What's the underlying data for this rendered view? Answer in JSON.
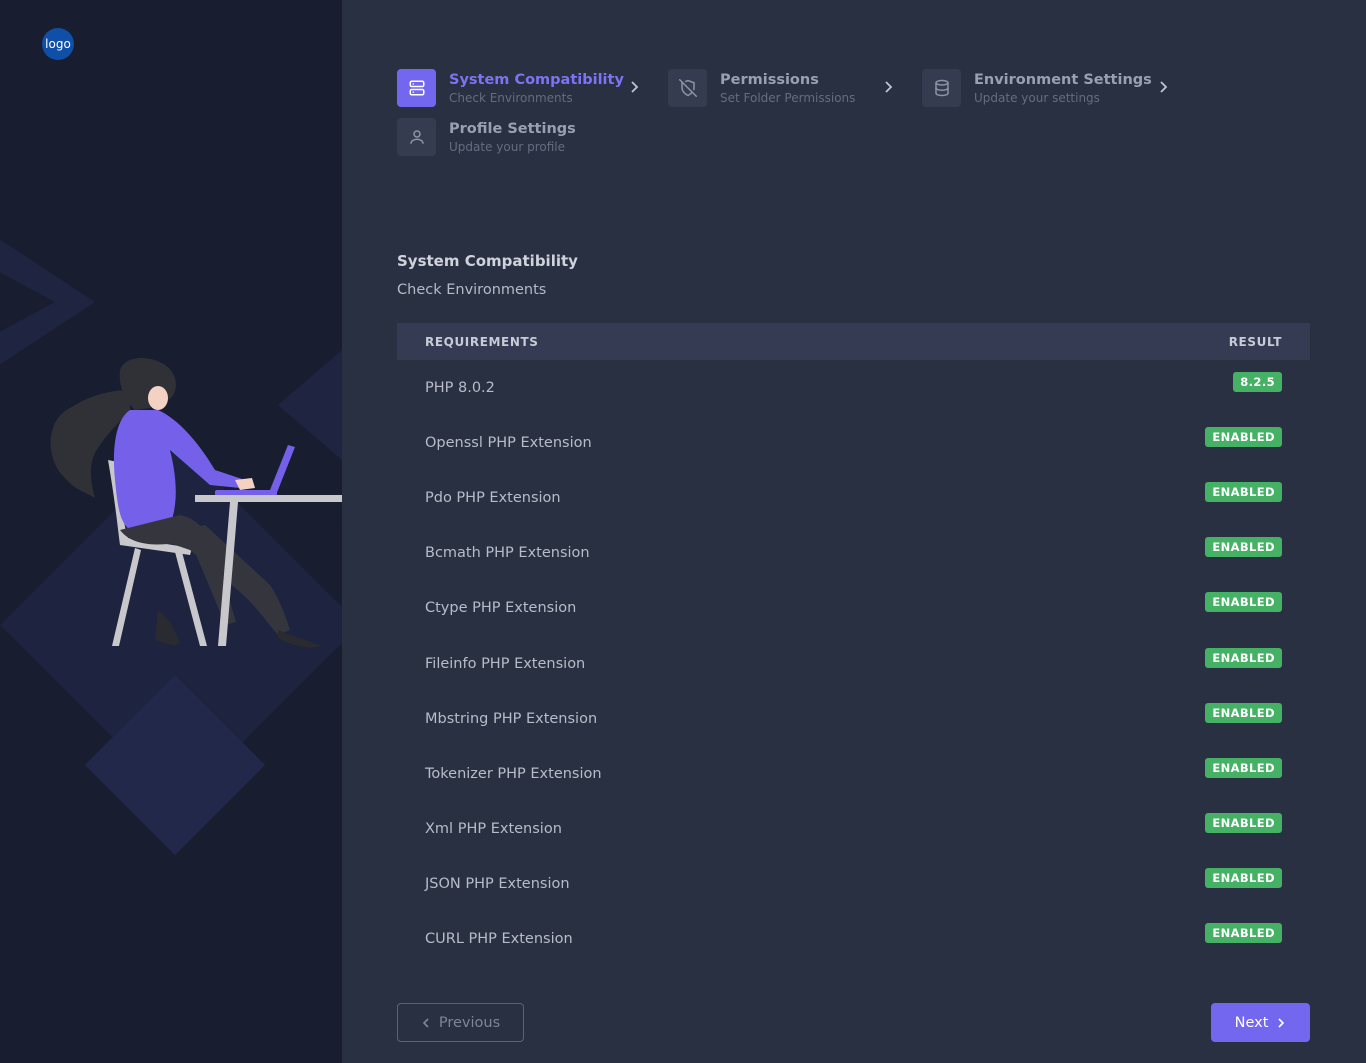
{
  "brand": {
    "logo_text": "logo"
  },
  "steps": [
    {
      "title": "System Compatibility",
      "subtitle": "Check Environments",
      "icon": "server-icon",
      "active": true
    },
    {
      "title": "Permissions",
      "subtitle": "Set Folder Permissions",
      "icon": "shield-off-icon",
      "active": false
    },
    {
      "title": "Environment Settings",
      "subtitle": "Update your settings",
      "icon": "database-icon",
      "active": false
    },
    {
      "title": "Profile Settings",
      "subtitle": "Update your profile",
      "icon": "user-icon",
      "active": false
    }
  ],
  "section": {
    "title": "System Compatibility",
    "subtitle": "Check Environments"
  },
  "table": {
    "headers": {
      "requirements": "REQUIREMENTS",
      "result": "RESULT"
    },
    "rows": [
      {
        "name": "PHP 8.0.2",
        "result": "8.2.5"
      },
      {
        "name": "Openssl PHP Extension",
        "result": "ENABLED"
      },
      {
        "name": "Pdo PHP Extension",
        "result": "ENABLED"
      },
      {
        "name": "Bcmath PHP Extension",
        "result": "ENABLED"
      },
      {
        "name": "Ctype PHP Extension",
        "result": "ENABLED"
      },
      {
        "name": "Fileinfo PHP Extension",
        "result": "ENABLED"
      },
      {
        "name": "Mbstring PHP Extension",
        "result": "ENABLED"
      },
      {
        "name": "Tokenizer PHP Extension",
        "result": "ENABLED"
      },
      {
        "name": "Xml PHP Extension",
        "result": "ENABLED"
      },
      {
        "name": "JSON PHP Extension",
        "result": "ENABLED"
      },
      {
        "name": "CURL PHP Extension",
        "result": "ENABLED"
      }
    ]
  },
  "buttons": {
    "previous": "Previous",
    "next": "Next"
  },
  "colors": {
    "accent": "#7367f0",
    "success": "#44b164",
    "sidebar": "#181d30",
    "background": "#283042"
  }
}
